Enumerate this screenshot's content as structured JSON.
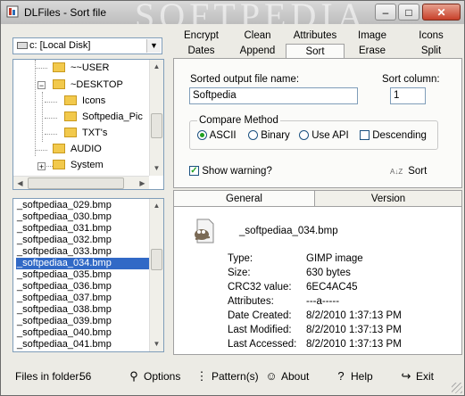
{
  "window": {
    "title": "DLFiles - Sort file",
    "watermark": "SOFTPEDIA"
  },
  "drive": {
    "selected": "c: [Local Disk]"
  },
  "tree": {
    "items": [
      {
        "label": "~~USER"
      },
      {
        "label": "~DESKTOP"
      },
      {
        "label": "Icons"
      },
      {
        "label": "Softpedia_Pic"
      },
      {
        "label": "TXT's"
      },
      {
        "label": "AUDIO"
      },
      {
        "label": "System"
      }
    ]
  },
  "files": [
    "_softpediaa_029.bmp",
    "_softpediaa_030.bmp",
    "_softpediaa_031.bmp",
    "_softpediaa_032.bmp",
    "_softpediaa_033.bmp",
    "_softpediaa_034.bmp",
    "_softpediaa_035.bmp",
    "_softpediaa_036.bmp",
    "_softpediaa_037.bmp",
    "_softpediaa_038.bmp",
    "_softpediaa_039.bmp",
    "_softpediaa_040.bmp",
    "_softpediaa_041.bmp"
  ],
  "selected_file_index": 5,
  "tabs": {
    "row1": [
      "Encrypt",
      "Clean",
      "Attributes",
      "Image",
      "Icons"
    ],
    "row2": [
      "Dates",
      "Append",
      "Sort",
      "Erase",
      "Split"
    ],
    "active": "Sort"
  },
  "sort": {
    "output_label": "Sorted output file name:",
    "output_value": "Softpedia",
    "column_label": "Sort column:",
    "column_value": "1",
    "compare_title": "Compare Method",
    "ascii": "ASCII",
    "binary": "Binary",
    "use_api": "Use API",
    "descending": "Descending",
    "show_warning": "Show warning?",
    "sort_button": "Sort"
  },
  "info": {
    "tab_general": "General",
    "tab_version": "Version",
    "filename": "_softpediaa_034.bmp",
    "rows": [
      {
        "k": "Type:",
        "v": "GIMP image"
      },
      {
        "k": "Size:",
        "v": "630 bytes"
      },
      {
        "k": "CRC32 value:",
        "v": "6EC4AC45"
      },
      {
        "k": "Attributes:",
        "v": "---a-----"
      },
      {
        "k": "Date Created:",
        "v": "8/2/2010 1:37:13 PM"
      },
      {
        "k": "Last Modified:",
        "v": "8/2/2010 1:37:13 PM"
      },
      {
        "k": "Last Accessed:",
        "v": "8/2/2010 1:37:13 PM"
      }
    ]
  },
  "status": {
    "files_label": "Files in folder:",
    "files_count": "56",
    "options": "Options",
    "patterns": "Pattern(s)",
    "about": "About",
    "help": "Help",
    "exit": "Exit"
  }
}
